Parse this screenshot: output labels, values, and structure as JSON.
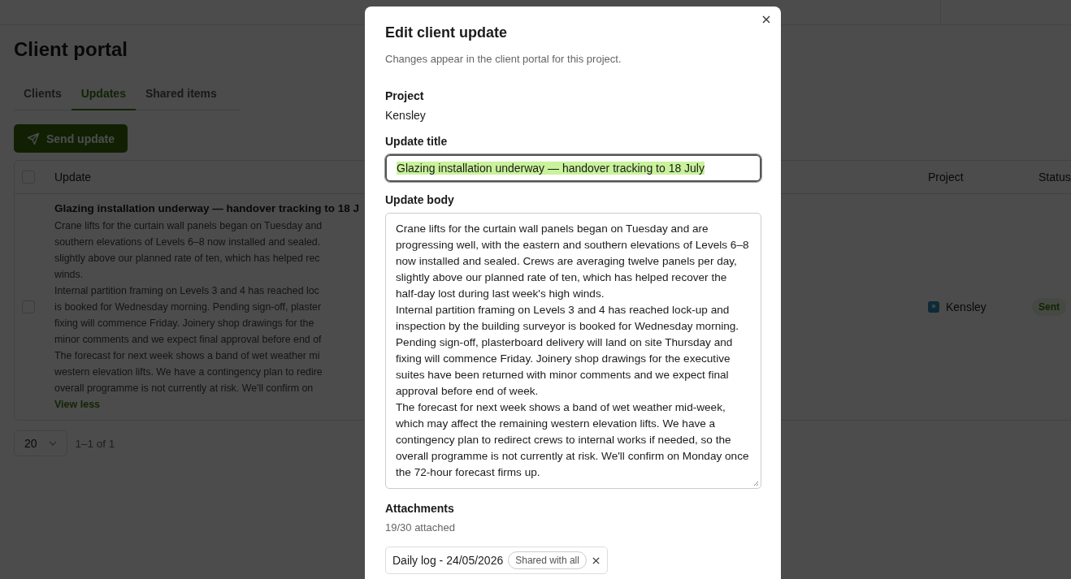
{
  "page": {
    "title": "Client portal"
  },
  "tabs": [
    {
      "label": "Clients",
      "selected": false
    },
    {
      "label": "Updates",
      "selected": true
    },
    {
      "label": "Shared items",
      "selected": false
    }
  ],
  "send_button": "Send update",
  "table": {
    "header_checked": false,
    "columns": [
      "Update",
      "Project",
      "Status"
    ],
    "rows": [
      {
        "checked": false,
        "title": "Glazing installation underway — handover tracking to 18 J",
        "body_lines": [
          "Crane lifts for the curtain wall panels began on Tuesday and",
          "southern elevations of Levels 6–8 now installed and sealed.",
          "slightly above our planned rate of ten, which has helped rec",
          "winds.",
          "Internal partition framing on Levels 3 and 4 has reached loc",
          "is booked for Wednesday morning. Pending sign-off, plaster",
          "fixing will commence Friday. Joinery shop drawings for the",
          "minor comments and we expect final approval before end of",
          "The forecast for next week shows a band of wet weather mi",
          "western elevation lifts. We have a contingency plan to redire",
          "overall programme is not currently at risk. We'll confirm on"
        ],
        "toggle": "View less",
        "project": "Kensley",
        "color": "#0d2b37",
        "status": "Sent"
      }
    ]
  },
  "pagination": {
    "page_size": "20",
    "range": "1–1 of 1"
  },
  "dialog": {
    "title": "Edit client update",
    "description": "Changes appear in the client portal for this project.",
    "project": {
      "label": "Project",
      "value": "Kensley"
    },
    "title_field": {
      "label": "Update title",
      "value": "Glazing installation underway — handover tracking to 18 July",
      "text_selected": true
    },
    "body_field": {
      "label": "Update body",
      "value": "Crane lifts for the curtain wall panels began on Tuesday and are progressing well, with the eastern and southern elevations of Levels 6–8 now installed and sealed. Crews are averaging twelve panels per day, slightly above our planned rate of ten, which has helped recover the half-day lost during last week's high winds.\nInternal partition framing on Levels 3 and 4 has reached lock-up and inspection by the building surveyor is booked for Wednesday morning. Pending sign-off, plasterboard delivery will land on site Thursday and fixing will commence Friday. Joinery shop drawings for the executive suites have been returned with minor comments and we expect final approval before end of week.\nThe forecast for next week shows a band of wet weather mid-week, which may affect the remaining western elevation lifts. We have a contingency plan to redirect crews to internal works if needed, so the overall programme is not currently at risk. We'll confirm on Monday once the 72-hour forecast firms up."
    },
    "attachments": {
      "label": "Attachments",
      "count": "19/30 attached",
      "items": [
        {
          "name": "Daily log - 24/05/2026",
          "tag": "Shared with all"
        }
      ]
    }
  }
}
